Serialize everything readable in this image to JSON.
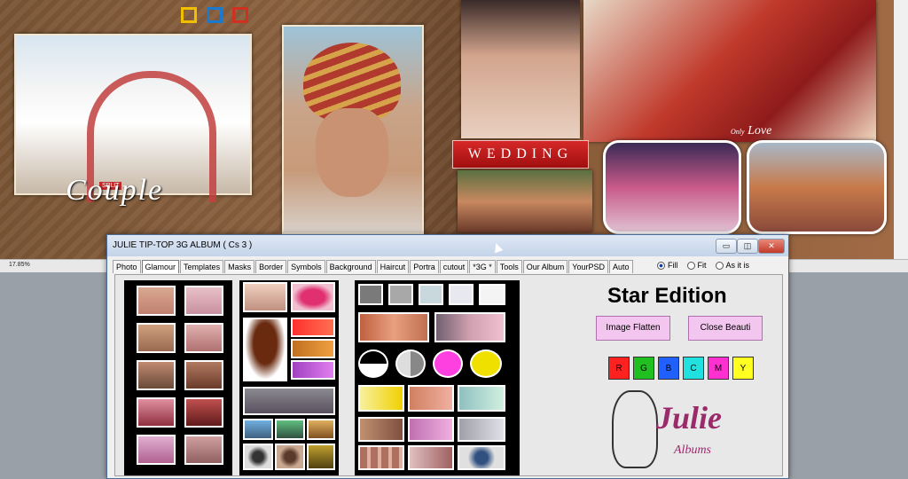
{
  "canvas": {
    "zoom_label": "17.85%",
    "couple_text": "Couple",
    "couple_tag": "SPLIT",
    "wedding_banner": "WEDDING",
    "love_text": "Love",
    "love_prefix": "Only",
    "color_squares": [
      "#f0c000",
      "#1a7ad0",
      "#d03020"
    ]
  },
  "dialog": {
    "title": "JULIE TIP-TOP 3G ALBUM ( Cs 3 )",
    "window_buttons": {
      "minimize": "▭",
      "restore": "◫",
      "close": "✕"
    },
    "tabs": [
      "Photo",
      "Glamour",
      "Templates",
      "Masks",
      "Border",
      "Symbols",
      "Background",
      "Haircut",
      "Portra",
      "cutout",
      "*3G *",
      "Tools",
      "Our Album",
      "YourPSD",
      "Auto"
    ],
    "active_tab": "Glamour",
    "fit_options": [
      "Fill",
      "Fit",
      "As it is"
    ],
    "selected_fit": "Fill",
    "star_edition": "Star Edition",
    "image_flatten": "Image Flatten",
    "close_beauti": "Close Beauti",
    "color_buttons": [
      {
        "label": "R",
        "color": "#ff2020"
      },
      {
        "label": "G",
        "color": "#20c020"
      },
      {
        "label": "B",
        "color": "#2060ff"
      },
      {
        "label": "C",
        "color": "#20e0e0"
      },
      {
        "label": "M",
        "color": "#ff30d0"
      },
      {
        "label": "Y",
        "color": "#ffff20"
      }
    ],
    "logo_word": "Julie",
    "logo_sub": "Albums"
  }
}
